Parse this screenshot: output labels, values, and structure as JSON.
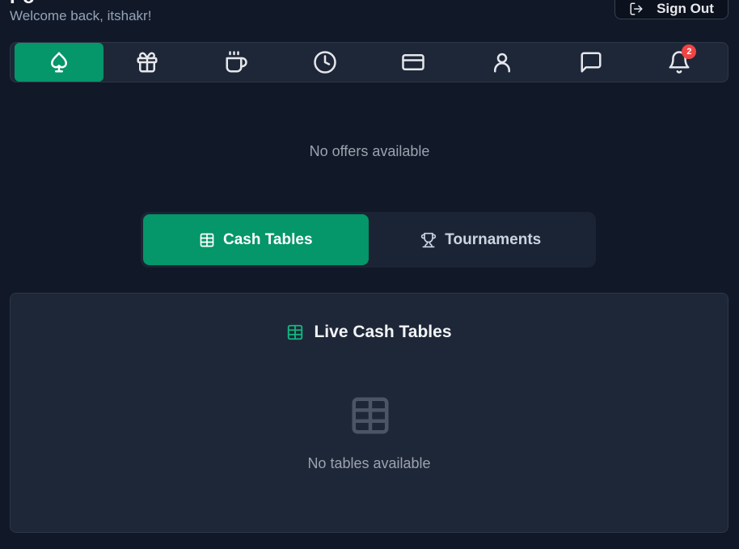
{
  "header": {
    "welcome": "Welcome back, itshakr!",
    "signout_label": "Sign Out"
  },
  "nav": {
    "items": [
      {
        "icon": "spade-icon",
        "active": true
      },
      {
        "icon": "gift-icon",
        "active": false
      },
      {
        "icon": "coffee-icon",
        "active": false
      },
      {
        "icon": "clock-icon",
        "active": false
      },
      {
        "icon": "credit-card-icon",
        "active": false
      },
      {
        "icon": "user-icon",
        "active": false
      },
      {
        "icon": "message-icon",
        "active": false
      },
      {
        "icon": "bell-icon",
        "active": false
      }
    ],
    "notification_count": "2"
  },
  "offers": {
    "empty_text": "No offers available"
  },
  "tabs": [
    {
      "label": "Cash Tables",
      "icon": "table-icon",
      "active": true
    },
    {
      "label": "Tournaments",
      "icon": "trophy-icon",
      "active": false
    }
  ],
  "panel": {
    "title": "Live Cash Tables",
    "empty_text": "No tables available"
  },
  "colors": {
    "background": "#111827",
    "accent": "#059669",
    "badge": "#ef4444",
    "panel": "#1e2738"
  }
}
